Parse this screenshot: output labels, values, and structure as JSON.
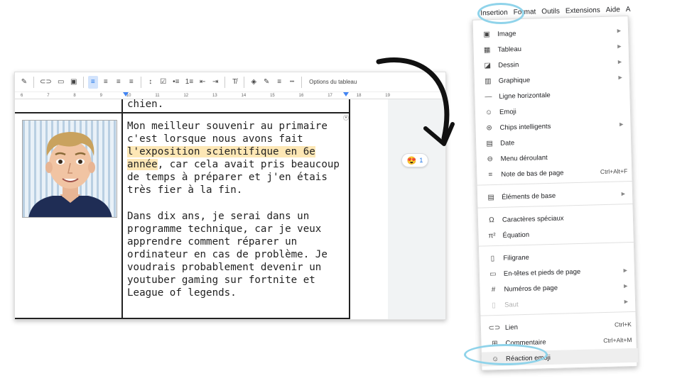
{
  "toolbar": {
    "pencil_icon": "✎",
    "link_icon": "⊂⊃",
    "comment_icon": "▭",
    "image_icon": "▣",
    "align_left_icon": "≡",
    "align_center_icon": "≡",
    "align_right_icon": "≡",
    "justify_icon": "≡",
    "line_spacing_icon": "↕",
    "checklist_icon": "☑",
    "bullet_list_icon": "•≡",
    "numbered_list_icon": "1≡",
    "indent_less_icon": "⇤",
    "indent_more_icon": "⇥",
    "clear_format_icon": "T̸",
    "fill_color_icon": "◈",
    "border_color_icon": "✎",
    "border_width_icon": "≡",
    "border_dash_icon": "┅",
    "table_options": "Options du tableau"
  },
  "ruler": {
    "ticks": [
      "6",
      "7",
      "8",
      "9",
      "10",
      "11",
      "12",
      "13",
      "14",
      "15",
      "16",
      "17",
      "18",
      "19"
    ]
  },
  "document": {
    "prev_line": "chien.",
    "para1_before": "Mon meilleur souvenir au primaire c'est lorsque nous avons fait ",
    "para1_highlight": "l'exposition scientifique en 6e année",
    "para1_after": ", car cela avait pris beaucoup de temps à préparer et j'en étais très fier à la fin.",
    "para2": "Dans dix ans, je serai dans un programme technique, car je veux apprendre comment réparer un ordinateur en cas de problème. Je voudrais probablement devenir un youtuber gaming sur fortnite et League of legends."
  },
  "reaction": {
    "emoji": "😍",
    "count": "1"
  },
  "menubar": {
    "items": [
      "Insertion",
      "Format",
      "Outils",
      "Extensions",
      "Aide",
      "A"
    ]
  },
  "menu": {
    "image": "Image",
    "table": "Tableau",
    "drawing": "Dessin",
    "chart": "Graphique",
    "hline": "Ligne horizontale",
    "emoji": "Emoji",
    "smart_chips": "Chips intelligents",
    "date": "Date",
    "dropdown": "Menu déroulant",
    "footnote": "Note de bas de page",
    "footnote_shortcut": "Ctrl+Alt+F",
    "building_blocks": "Éléments de base",
    "special_chars": "Caractères spéciaux",
    "equation": "Équation",
    "watermark": "Filigrane",
    "headers_footers": "En-têtes et pieds de page",
    "page_numbers": "Numéros de page",
    "break": "Saut",
    "link": "Lien",
    "link_shortcut": "Ctrl+K",
    "comment": "Commentaire",
    "comment_shortcut": "Ctrl+Alt+M",
    "emoji_reaction": "Réaction emoji"
  },
  "menu_icons": {
    "image": "▣",
    "table": "▦",
    "drawing": "◪",
    "chart": "▥",
    "hline": "—",
    "emoji": "☺",
    "smart_chips": "⊜",
    "date": "▤",
    "dropdown": "⊖",
    "footnote": "≡",
    "building_blocks": "▤",
    "special_chars": "Ω",
    "equation": "π²",
    "watermark": "▯",
    "headers_footers": "▭",
    "page_numbers": "#",
    "break": "▯",
    "link": "⊂⊃",
    "comment": "⊞",
    "emoji_reaction": "☺",
    "chevron": "▶"
  },
  "colors": {
    "highlight": "#fde7b5",
    "callout_circle": "#8fd3ea",
    "accent": "#1a73e8"
  }
}
